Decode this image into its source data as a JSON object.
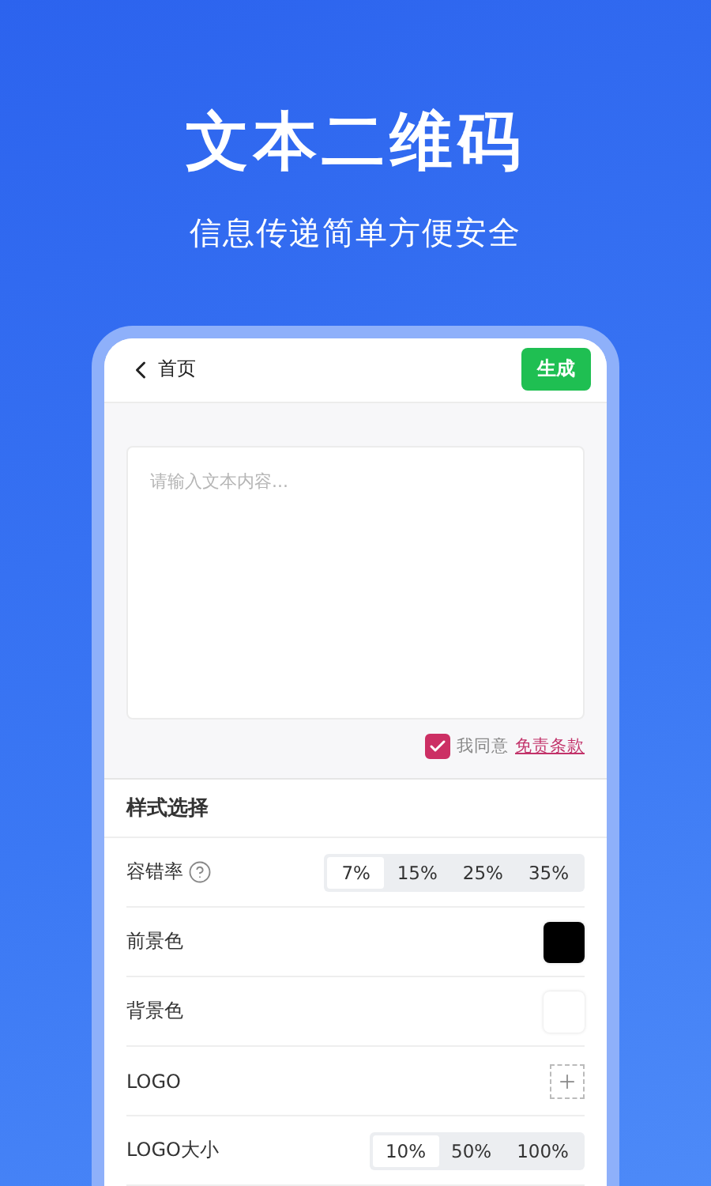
{
  "hero": {
    "title": "文本二维码",
    "subtitle": "信息传递简单方便安全"
  },
  "nav": {
    "back_label": "首页",
    "action": "生成"
  },
  "text_input": {
    "placeholder": "请输入文本内容..."
  },
  "agreement": {
    "checked": true,
    "text": "我同意",
    "link": "免责条款"
  },
  "style_section": {
    "title": "样式选择",
    "rows": [
      {
        "kind": "segmented",
        "label": "容错率",
        "help": true,
        "options": [
          {
            "label": "7%",
            "selected": true
          },
          {
            "label": "15%",
            "selected": false
          },
          {
            "label": "25%",
            "selected": false
          },
          {
            "label": "35%",
            "selected": false
          }
        ]
      },
      {
        "kind": "color",
        "label": "前景色",
        "color": "#000000"
      },
      {
        "kind": "color",
        "label": "背景色",
        "color": "#ffffff"
      },
      {
        "kind": "logo",
        "label": "LOGO"
      },
      {
        "kind": "segmented",
        "label": "LOGO大小",
        "help": false,
        "options": [
          {
            "label": "10%",
            "selected": true
          },
          {
            "label": "50%",
            "selected": false
          },
          {
            "label": "100%",
            "selected": false
          }
        ]
      }
    ]
  }
}
